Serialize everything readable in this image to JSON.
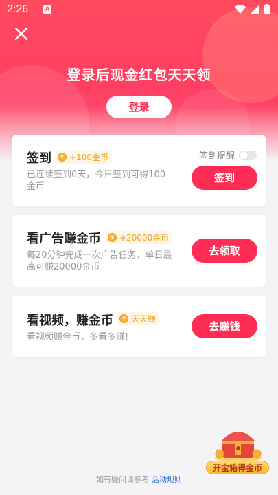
{
  "status_bar": {
    "time": "2:26",
    "notification_badge": "A"
  },
  "header": {
    "title": "登录后现金红包天天领",
    "login_label": "登录"
  },
  "checkin": {
    "title": "签到",
    "reward": "+100金币",
    "reminder_label": "签到提醒",
    "reminder_on": false,
    "desc_line1": "已连续签到0天，今日签到可得100",
    "desc_line2": "金币",
    "button_label": "签到"
  },
  "ad_task": {
    "title": "看广告赚金币",
    "reward": "+20000金币",
    "desc_line1": "每20分钟完成一次广告任务，单日最",
    "desc_line2": "高可赚20000金币",
    "button_label": "去领取"
  },
  "video_task": {
    "title": "看视频，赚金币",
    "reward": "天天赚",
    "desc": "看视频赚金币，多看多赚!",
    "button_label": "去赚钱"
  },
  "footer": {
    "text": "如有疑问请参考",
    "link": "活动规则"
  },
  "treasure": {
    "label": "开宝箱得金币"
  },
  "colors": {
    "accent": "#ff2d55",
    "coin": "#f2a01c",
    "link": "#2f6fd6"
  },
  "icons": [
    "close-icon",
    "wifi-icon",
    "signal-icon",
    "battery-icon",
    "coin-icon",
    "treasure-chest-icon"
  ]
}
